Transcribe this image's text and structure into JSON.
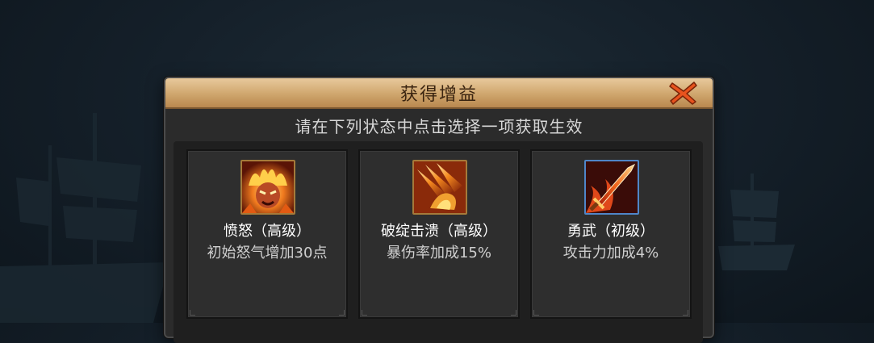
{
  "dialog": {
    "title": "获得增益",
    "subtitle": "请在下列状态中点击选择一项获取生效",
    "close_icon": "close-x-icon"
  },
  "buffs": [
    {
      "name": "愤怒（高级）",
      "desc": "初始怒气增加30点",
      "icon": "rage-face-icon"
    },
    {
      "name": "破绽击溃（高级）",
      "desc": "暴伤率加成15%",
      "icon": "flaming-claw-icon"
    },
    {
      "name": "勇武（初级）",
      "desc": "攻击力加成4%",
      "icon": "flaming-sword-icon"
    }
  ],
  "colors": {
    "title_bar": "#cfa66d",
    "panel": "#2b2b2b",
    "card": "#2e2e2e",
    "close_x": "#e8531e"
  }
}
